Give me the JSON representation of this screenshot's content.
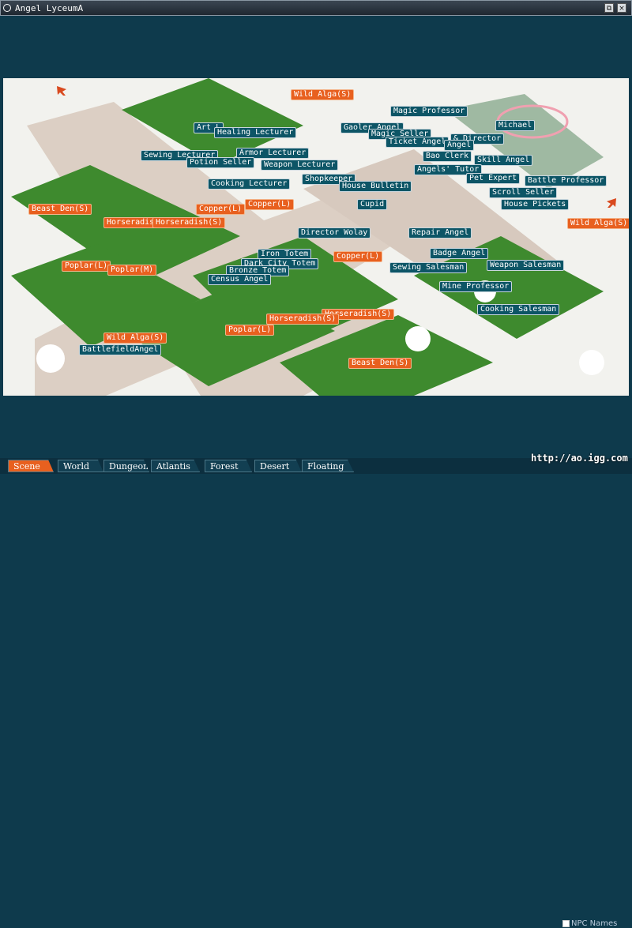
{
  "window": {
    "title": "Angel LyceumA",
    "restore_glyph": "⧉",
    "close_glyph": "×"
  },
  "map": {
    "npc_labels": [
      "Wild Alga(S)",
      "Magic Professor",
      "Michael",
      "Art L",
      "Healing Lecturer",
      "Gaoler Angel",
      "Magic Seller",
      "& Director",
      "Ticket Angel",
      "Angel",
      "Armor Lecturer",
      "Sewing Lecturer",
      "Potion Seller",
      "Bao Clerk",
      "Skill Angel",
      "Weapon Lecturer",
      "Angels' Tutor",
      "Shopkeeper",
      "Pet Expert",
      "Battle Professor",
      "Cooking Lecturer",
      "House Bulletin",
      "Scroll Seller",
      "Cupid",
      "House Pickets",
      "Director Wolay",
      "Repair Angel",
      "Iron Totem",
      "Badge Angel",
      "Dark City Totem",
      "Bronze Totem",
      "Sewing Salesman",
      "Weapon Salesman",
      "Census Angel",
      "Mine Professor",
      "Cooking Salesman",
      "BattlefieldAngel"
    ],
    "monster_labels": [
      "Wild Alga(S)",
      "Beast Den(S)",
      "Copper(L)",
      "Copper(L)",
      "Horseradish",
      "Horseradish(S)",
      "Wild Alga(S)",
      "Poplar(L)",
      "Poplar(M)",
      "Copper(L)",
      "Horseradish(S)",
      "Horseradish(S)",
      "Poplar(L)",
      "Wild Alga(S)",
      "Beast Den(S)"
    ]
  },
  "tabs": [
    "Scene",
    "World",
    "Dungeon",
    "Atlantis",
    "Forest",
    "Desert",
    "Floating"
  ],
  "npc_toggle_label": "NPC Names",
  "watermark": "http://ao.igg.com",
  "colors": {
    "npc_label": "#0d5566",
    "monster_label": "#e8601f",
    "grass": "#3e8a2e",
    "road": "#dccfc4",
    "frame": "#0e3a4c"
  }
}
